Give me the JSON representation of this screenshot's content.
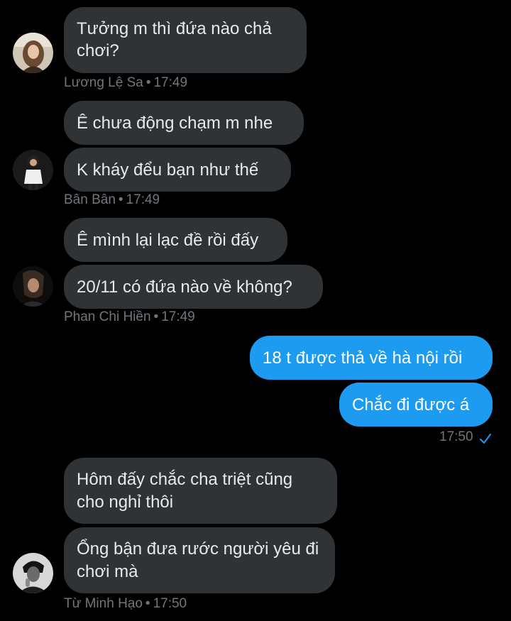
{
  "theme": {
    "background": "#000000",
    "incoming_bubble": "#2f3336",
    "outgoing_bubble": "#1d9bf0",
    "meta_text": "#71767b",
    "read_check": "#1d9bf0"
  },
  "groups": [
    {
      "sender": "Lương Lệ Sa",
      "time": "17:49",
      "separator": "•",
      "messages": [
        "Tưởng m thì đứa nào chả chơi?"
      ]
    },
    {
      "sender": "Bân Bân",
      "time": "17:49",
      "separator": "•",
      "messages": [
        "Ê chưa động chạm m nhe",
        "K kháy đểu bạn như thế"
      ]
    },
    {
      "sender": "Phan Chi Hiền",
      "time": "17:49",
      "separator": "•",
      "messages": [
        "Ê mình lại lạc đề rồi đấy",
        "20/11 có đứa nào về không?"
      ]
    },
    {
      "sender": "me",
      "time": "17:50",
      "status_icon": "read-check-icon",
      "messages": [
        "18 t được thả về hà nội rồi",
        "Chắc đi được á"
      ]
    },
    {
      "sender": "Từ Minh Hạo",
      "time": "17:50",
      "separator": "•",
      "messages": [
        "Hôm đấy chắc cha triệt cũng cho nghỉ thôi",
        "Ổng bận đưa rước người yêu đi chơi mà"
      ]
    }
  ]
}
